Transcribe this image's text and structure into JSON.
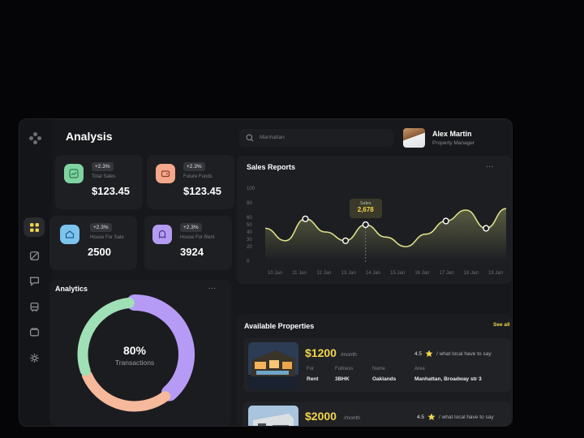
{
  "app": {
    "title": "Analysis"
  },
  "search": {
    "placeholder": "Manhattan"
  },
  "user": {
    "name": "Alex Martin",
    "role": "Property Manager"
  },
  "sidebar": {
    "items": [
      {
        "icon": "grid-icon",
        "active": true
      },
      {
        "icon": "tag-icon"
      },
      {
        "icon": "chat-icon"
      },
      {
        "icon": "bus-icon"
      },
      {
        "icon": "wallet-icon"
      },
      {
        "icon": "gear-icon"
      }
    ]
  },
  "stats": [
    {
      "badge": "+2.3%",
      "label": "Total Sales",
      "value": "$123.45",
      "icon": "chart-icon",
      "color": "#7fd3a0"
    },
    {
      "badge": "+2.3%",
      "label": "Future Funds",
      "value": "$123.45",
      "icon": "wallet-icon",
      "color": "#f4a78a"
    },
    {
      "badge": "+2.3%",
      "label": "House For Sale",
      "value": "2500",
      "icon": "mail-icon",
      "color": "#7cc3ee"
    },
    {
      "badge": "+2.3%",
      "label": "House For Rent",
      "value": "3924",
      "icon": "ghost-icon",
      "color": "#b39cf2"
    }
  ],
  "analytics": {
    "title": "Analytics",
    "more": "...",
    "percent": "80%",
    "label": "Transactions",
    "segments": [
      {
        "value": 40,
        "color": "#b69bf6"
      },
      {
        "value": 30,
        "color": "#f6b99b"
      },
      {
        "value": 30,
        "color": "#9fe0b6"
      }
    ]
  },
  "chart_data": {
    "type": "line",
    "title": "Sales Reports",
    "x": [
      "10 Jan",
      "11 Jan",
      "12 Jan",
      "13 Jan",
      "14 Jan",
      "15 Jan",
      "16 Jan",
      "17 Jan",
      "18 Jan",
      "19 Jan"
    ],
    "yticks": [
      0,
      20,
      30,
      40,
      50,
      60,
      80,
      100
    ],
    "ylim": [
      0,
      100
    ],
    "series": [
      {
        "values": [
          45,
          28,
          58,
          40,
          28,
          50,
          33,
          20,
          37,
          55,
          70,
          45,
          72
        ]
      }
    ],
    "tooltip": {
      "label": "Sales",
      "value": "2,678"
    },
    "more": "..."
  },
  "properties": {
    "title": "Available Properties",
    "see_all": "See all",
    "items": [
      {
        "price": "$1200",
        "per": "/month",
        "rating": "4.5",
        "quote": "/ what local have to say",
        "fields": [
          {
            "k": "For",
            "v": "Rent"
          },
          {
            "k": "Fullness",
            "v": "3BHK"
          },
          {
            "k": "Name",
            "v": "Oaklands"
          },
          {
            "k": "Area",
            "v": "Manhattan, Broadway str 3"
          }
        ]
      },
      {
        "price": "$2000",
        "per": "/month",
        "rating": "4.5",
        "quote": "/ what local have to say"
      }
    ]
  }
}
